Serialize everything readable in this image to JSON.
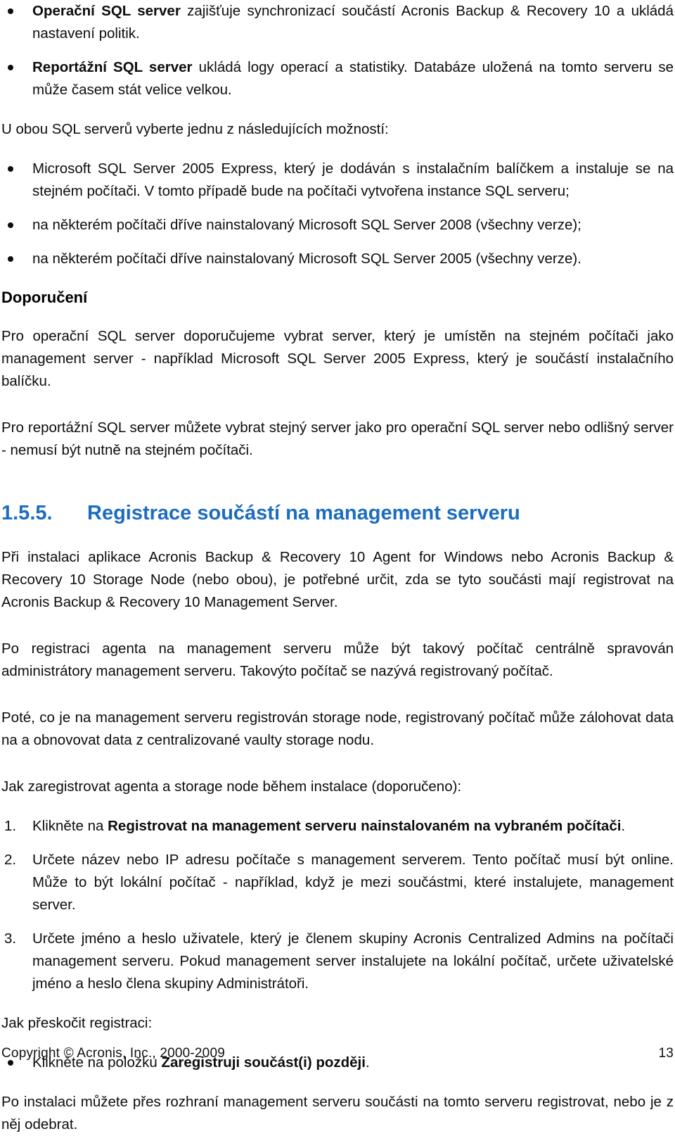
{
  "document": {
    "language": "cs",
    "heading_color": "#1c6cc0",
    "body_color": "#0d0d0d"
  },
  "top_bullets": [
    {
      "bold_lead": "Operační SQL server",
      "rest": " zajišťuje synchronizací součástí Acronis Backup & Recovery 10 a ukládá nastavení politik."
    },
    {
      "bold_lead": "Reportážní SQL server",
      "rest": " ukládá logy operací a statistiky. Databáze uložená na tomto serveru se může časem stát velice velkou."
    }
  ],
  "intro_paragraph": "U obou SQL serverů vyberte jednu z následujících možností:",
  "option_bullets": [
    "Microsoft SQL Server 2005 Express, který je dodáván s instalačním balíčkem a instaluje se na stejném počítači. V tomto případě bude na počítači vytvořena instance SQL serveru;",
    "na některém počítači dříve nainstalovaný Microsoft SQL Server 2008 (všechny verze);",
    "na některém počítači dříve nainstalovaný Microsoft SQL Server 2005 (všechny verze)."
  ],
  "recommendation": {
    "heading": "Doporučení",
    "paragraph_1": "Pro operační SQL server doporučujeme vybrat server, který je umístěn na stejném počítači jako management server - například Microsoft SQL Server 2005 Express, který je součástí instalačního balíčku.",
    "paragraph_2": "Pro reportážní SQL server můžete vybrat stejný server jako pro operační SQL server nebo odlišný server - nemusí být nutně na stejném počítači."
  },
  "section": {
    "number": "1.5.5.",
    "title": "Registrace součástí na management serveru",
    "paragraph_1": "Při instalaci aplikace Acronis Backup & Recovery 10 Agent for Windows nebo Acronis Backup & Recovery 10 Storage Node (nebo obou), je potřebné určit, zda se tyto součásti mají registrovat na Acronis Backup & Recovery 10 Management Server.",
    "paragraph_2": "Po registraci agenta na management serveru může být takový počítač centrálně spravován administrátory management serveru. Takovýto počítač se nazývá registrovaný počítač.",
    "paragraph_3": "Poté, co je na management serveru registrován storage node, registrovaný počítač může zálohovat data na a obnovovat data z centralizované vaulty storage nodu.",
    "lead_in_register": "Jak zaregistrovat agenta a storage node během instalace (doporučeno):",
    "steps": [
      {
        "marker": "1.",
        "prefix": "Klikněte na ",
        "bold": "Registrovat na management serveru nainstalovaném na vybraném počítači",
        "suffix": "."
      },
      {
        "marker": "2.",
        "prefix": "Určete název nebo IP adresu počítače s management serverem. Tento počítač musí být online. Může to být lokální počítač - například, když je mezi součástmi, které instalujete, management server.",
        "bold": "",
        "suffix": ""
      },
      {
        "marker": "3.",
        "prefix": "Určete jméno a heslo uživatele, který je členem skupiny Acronis Centralized Admins na počítači management serveru. Pokud management server instalujete na lokální počítač, určete uživatelské jméno a heslo člena skupiny Administrátoři.",
        "bold": "",
        "suffix": ""
      }
    ],
    "lead_in_skip": "Jak přeskočit registraci:",
    "skip_bullet": {
      "prefix": "Klikněte na položku ",
      "bold": "Zaregistruji součást(i) později",
      "suffix": "."
    },
    "paragraph_closing": "Po instalaci můžete přes rozhraní management serveru součásti na tomto serveru registrovat, nebo je z něj odebrat."
  },
  "footer": {
    "copyright": "Copyright © Acronis, Inc., 2000-2009",
    "page_number": "13"
  }
}
